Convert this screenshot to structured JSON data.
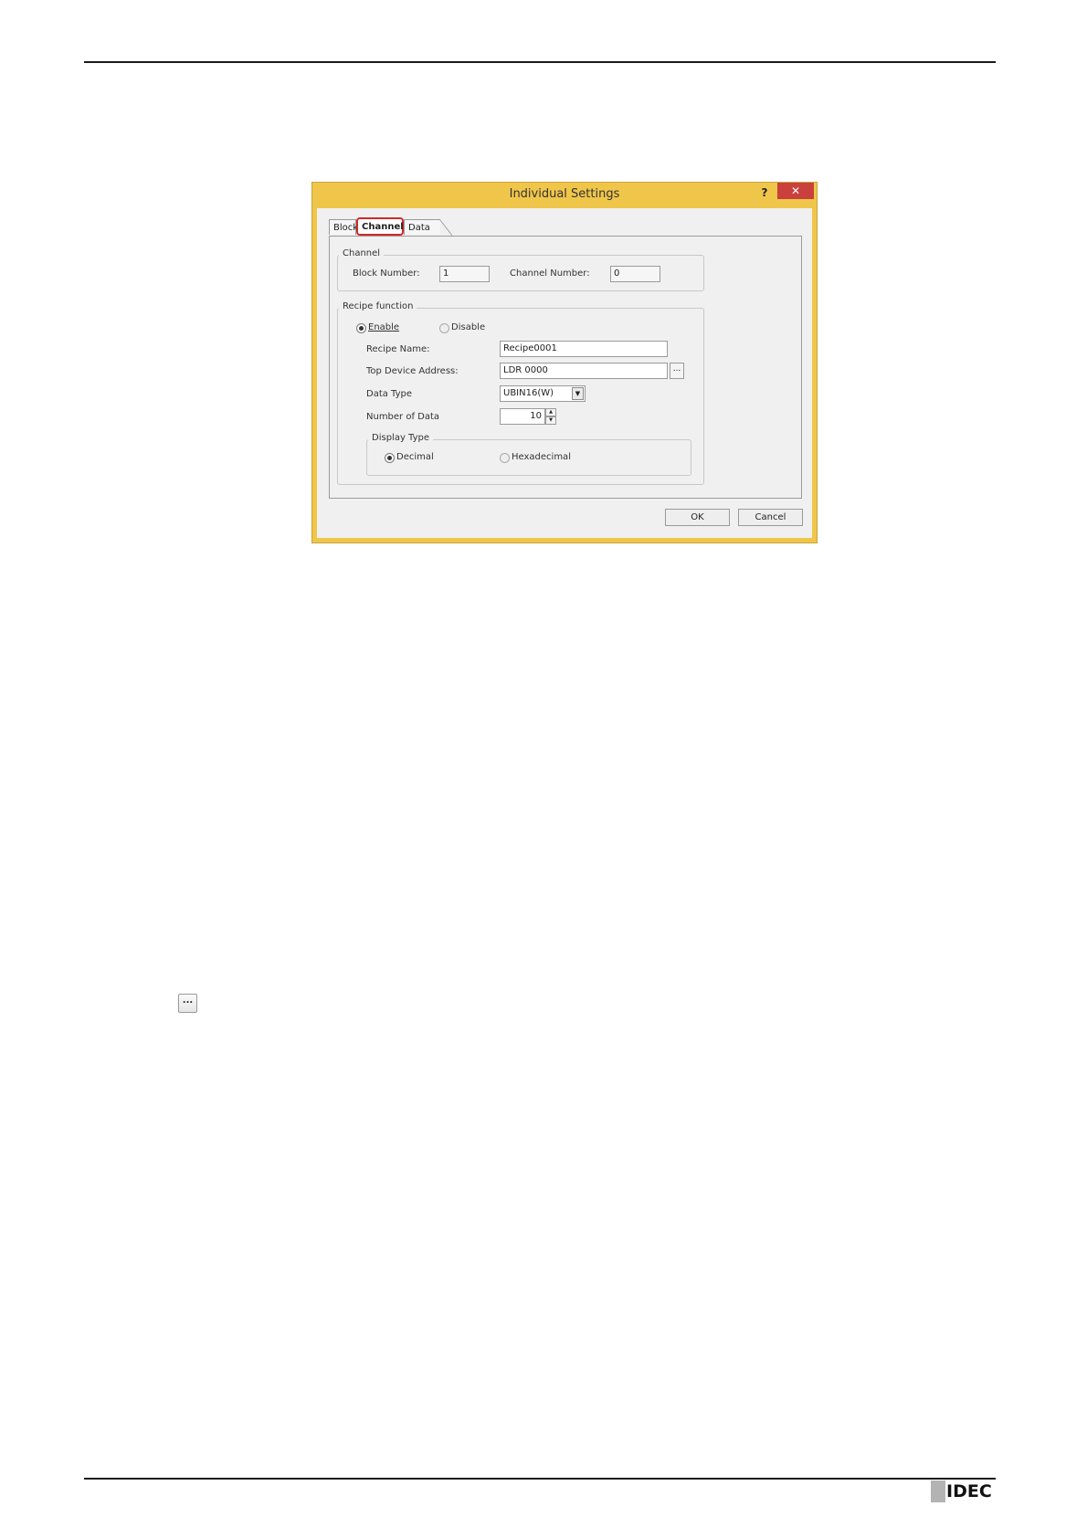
{
  "dialog": {
    "title": "Individual Settings",
    "help_label": "?",
    "close_label": "✕",
    "tabs": [
      "Block",
      "Channel",
      "Data"
    ],
    "channel_group": {
      "legend": "Channel",
      "block_number_label": "Block Number:",
      "block_number_value": "1",
      "channel_number_label": "Channel Number:",
      "channel_number_value": "0"
    },
    "recipe_group": {
      "legend": "Recipe function",
      "enable_label": "Enable",
      "disable_label": "Disable",
      "enable_selected": true,
      "recipe_name_label": "Recipe Name:",
      "recipe_name_value": "Recipe0001",
      "top_device_label": "Top Device Address:",
      "top_device_value": "LDR 0000",
      "browse_label": "...",
      "data_type_label": "Data Type",
      "data_type_value": "UBIN16(W)",
      "number_of_data_label": "Number of Data",
      "number_of_data_value": "10",
      "display_type": {
        "legend": "Display Type",
        "decimal_label": "Decimal",
        "hexadecimal_label": "Hexadecimal",
        "decimal_selected": true
      }
    },
    "ok_label": "OK",
    "cancel_label": "Cancel"
  },
  "inline_icon": {
    "label": "...",
    "icon": "ellipsis-button-icon"
  },
  "footer": {
    "logo_text": "IDEC"
  }
}
